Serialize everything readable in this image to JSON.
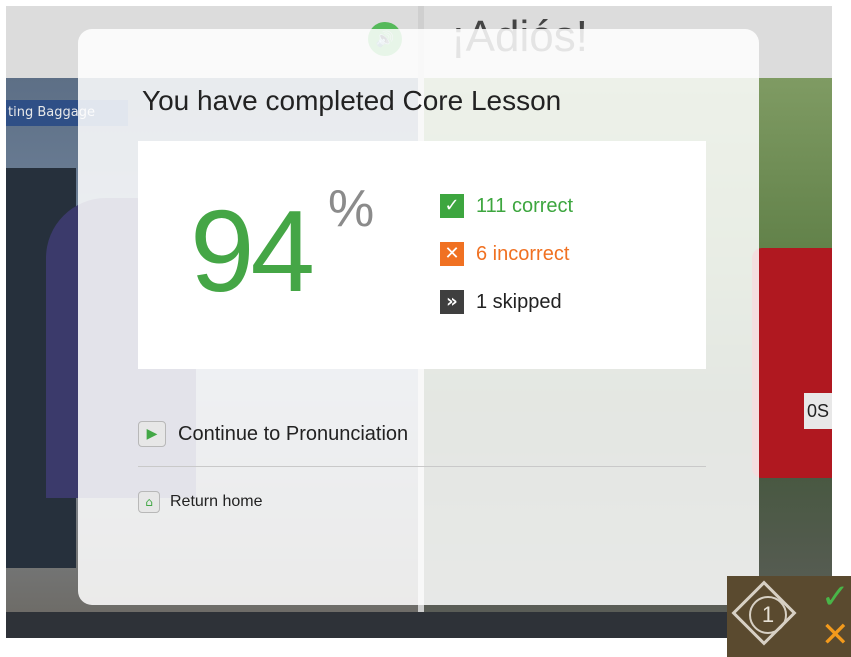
{
  "background": {
    "phrase": "¡Adiós!",
    "sign_text": "ting Baggage",
    "plate_text": "0S"
  },
  "modal": {
    "title": "You have completed Core Lesson",
    "score": {
      "value": "94",
      "unit": "%"
    },
    "stats": {
      "correct": "111 correct",
      "incorrect": "6 incorrect",
      "skipped": "1 skipped"
    },
    "actions": {
      "continue_label": "Continue to Pronunciation",
      "home_label": "Return home"
    }
  },
  "badge": {
    "number": "1"
  },
  "colors": {
    "accent_green": "#45a646",
    "incorrect_orange": "#f07122",
    "skipped_gray": "#3f3f3f"
  },
  "icons": [
    "speaker-icon",
    "check-icon",
    "x-icon",
    "skip-icon",
    "play-icon",
    "home-icon"
  ]
}
